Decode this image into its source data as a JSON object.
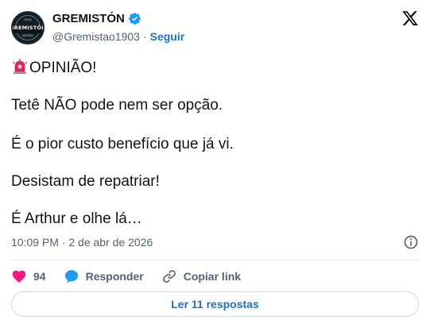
{
  "author": {
    "name": "GREMISTÓN",
    "handle": "@Gremistao1903",
    "separator": "·",
    "follow_label": "Seguir",
    "avatar_text": "GREMISTÓN",
    "avatar_top": "NOVA",
    "avatar_bottom": "VERSÃO"
  },
  "tweet": {
    "lines": [
      "OPINIÃO!",
      "Tetê NÃO pode nem ser opção.",
      "É o pior custo benefício que já vi.",
      "Desistam de repatriar!",
      "É Arthur e olhe lá…"
    ],
    "timestamp": "10:09 PM · 2 de abr de 2026"
  },
  "actions": {
    "likes_count": "94",
    "reply_label": "Responder",
    "copy_link_label": "Copiar link"
  },
  "read_replies_label": "Ler 11 respostas",
  "colors": {
    "accent": "#1d74b8",
    "like": "#f91880",
    "verified": "#1d9bf0",
    "text": "#0f1419",
    "muted": "#536471"
  },
  "icons": [
    "verified-badge-icon",
    "x-logo-icon",
    "siren-emoji-icon",
    "info-icon",
    "heart-icon",
    "reply-icon",
    "link-icon"
  ]
}
